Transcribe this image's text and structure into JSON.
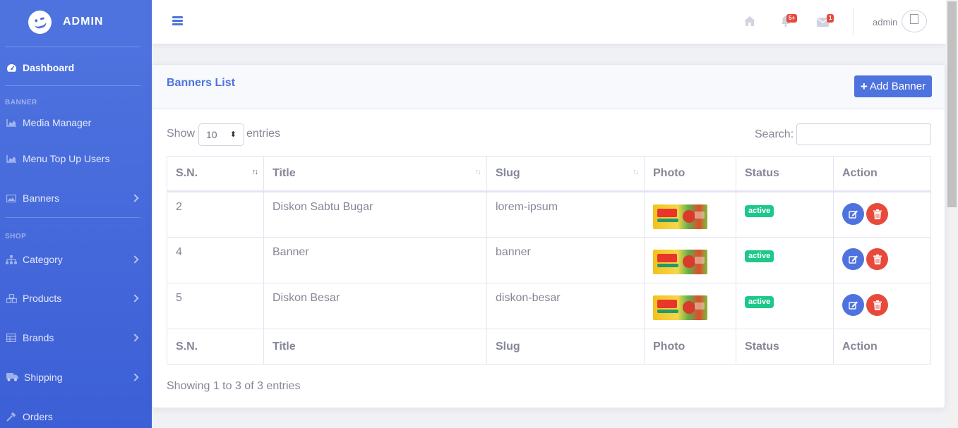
{
  "sidebar": {
    "brand": "ADMIN",
    "dashboard": "Dashboard",
    "heading_banner": "BANNER",
    "media_manager": "Media Manager",
    "menu_top_up": "Menu Top Up Users",
    "banners": "Banners",
    "heading_shop": "SHOP",
    "category": "Category",
    "products": "Products",
    "brands": "Brands",
    "shipping": "Shipping",
    "orders": "Orders"
  },
  "topbar": {
    "bell_badge": "5+",
    "mail_badge": "1",
    "user_name": "admin"
  },
  "card": {
    "title": "Banners List",
    "add_button": "Add Banner",
    "show_label": "Show",
    "entries_value": "10",
    "entries_label": "entries",
    "search_label": "Search:",
    "search_value": ""
  },
  "table": {
    "headers": [
      "S.N.",
      "Title",
      "Slug",
      "Photo",
      "Status",
      "Action"
    ],
    "rows": [
      {
        "sn": "2",
        "title": "Diskon Sabtu Bugar",
        "slug": "lorem-ipsum",
        "status": "active"
      },
      {
        "sn": "4",
        "title": "Banner",
        "slug": "banner",
        "status": "active"
      },
      {
        "sn": "5",
        "title": "Diskon Besar",
        "slug": "diskon-besar",
        "status": "active"
      }
    ],
    "info": "Showing 1 to 3 of 3 entries"
  },
  "colors": {
    "primary": "#4e73df",
    "success": "#1cc88a",
    "danger": "#e74a3b",
    "text": "#858796"
  }
}
